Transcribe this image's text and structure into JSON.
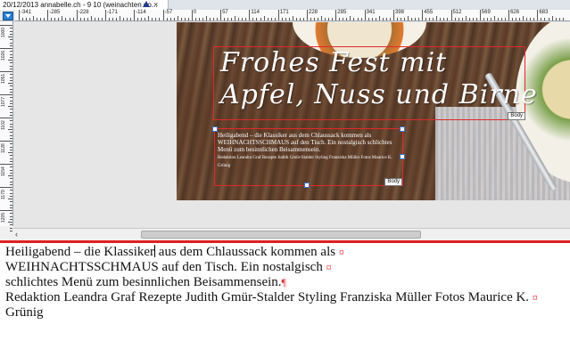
{
  "tab": {
    "title": "20/12/2013 annabelle.ch - 9 10 (weinachten do...",
    "close_glyph": "×"
  },
  "hruler": {
    "labels": [
      "-341",
      "-285",
      "-228",
      "-171",
      "-114",
      "-57",
      "0",
      "57",
      "114",
      "171",
      "228",
      "285",
      "341",
      "398",
      "455",
      "512",
      "569",
      "626",
      "683"
    ]
  },
  "vruler": {
    "labels": [
      "1000",
      "1026",
      "1051",
      "1077",
      "1102",
      "1128",
      "1154",
      "1179",
      "1205"
    ]
  },
  "layout_view": {
    "title_line1": "Frohes Fest mit",
    "title_line2": "Apfel, Nuss und Birne",
    "style_tag_title": "Body",
    "style_tag_body": "Body",
    "body_text": "Heiligabend – die Klassiker aus dem Chlaussack kommen als WEIHNACHTSSCHMAUS auf den Tisch. Ein nostalgisch schlichtes Menü zum besinnlichen Beisammensein.",
    "credit_text": "Redaktion Leandra Graf Rezepte Judith Gmür-Stalder Styling Franziska Müller Fotos Maurice K. Grünig"
  },
  "editor": {
    "line1_before_caret": "Heiligabend – die Klassiker",
    "line1_after_caret": " aus dem Chlaussack kommen als ",
    "line2": "WEIHNACHTSSCHMAUS auf den Tisch. Ein nostalgisch ",
    "line3": "schlichtes Menü zum besinnlichen Beisammensein.",
    "line4": "Redaktion Leandra Graf Rezepte Judith Gmür-Stalder Styling Franziska Müller Fotos Maurice K. ",
    "line5": "Grünig",
    "line_break_mark": "¤",
    "paragraph_mark": "¶"
  },
  "colors": {
    "frame_border": "#e02a2a",
    "split_bar": "#e02020",
    "accent_blue": "#2a7fd4"
  }
}
